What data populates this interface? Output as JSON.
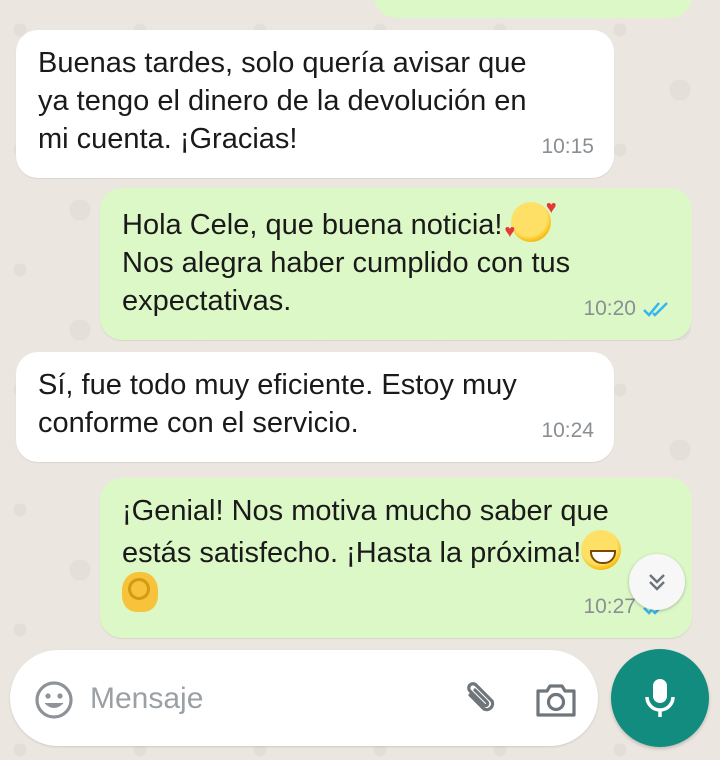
{
  "colors": {
    "incoming_bubble": "#ffffff",
    "outgoing_bubble": "#dcf8c6",
    "accent": "#128c7e",
    "read_ticks": "#34b7f1",
    "timestamp": "#8a8f93"
  },
  "messages": [
    {
      "direction": "incoming",
      "text": "Buenas tardes, solo quería avisar que\nya tengo el dinero de la devolución en\nmi cuenta. ¡Gracias!",
      "time": "10:15"
    },
    {
      "direction": "outgoing",
      "text_line1": "Hola Cele, que buena noticia! ",
      "text_rest": "Nos alegra haber cumplido con tus\nexpectativas.",
      "emoji": "smiling-face-with-hearts-icon",
      "time": "10:20",
      "status": "read"
    },
    {
      "direction": "incoming",
      "text": "Sí, fue todo muy eficiente. Estoy muy\nconforme con el servicio.",
      "time": "10:24"
    },
    {
      "direction": "outgoing",
      "text_line1": "¡Genial! Nos motiva mucho saber que",
      "text_line2": "estás satisfecho. ¡Hasta la próxima!",
      "emoji_inline": "grinning-face-icon",
      "emoji_last": "ok-hand-icon",
      "time": "10:27",
      "status": "read"
    }
  ],
  "composer": {
    "placeholder": "Mensaje",
    "icons": [
      "emoji-icon",
      "paperclip-icon",
      "camera-icon",
      "microphone-icon"
    ]
  },
  "scroll_button_icon": "double-chevron-down-icon"
}
